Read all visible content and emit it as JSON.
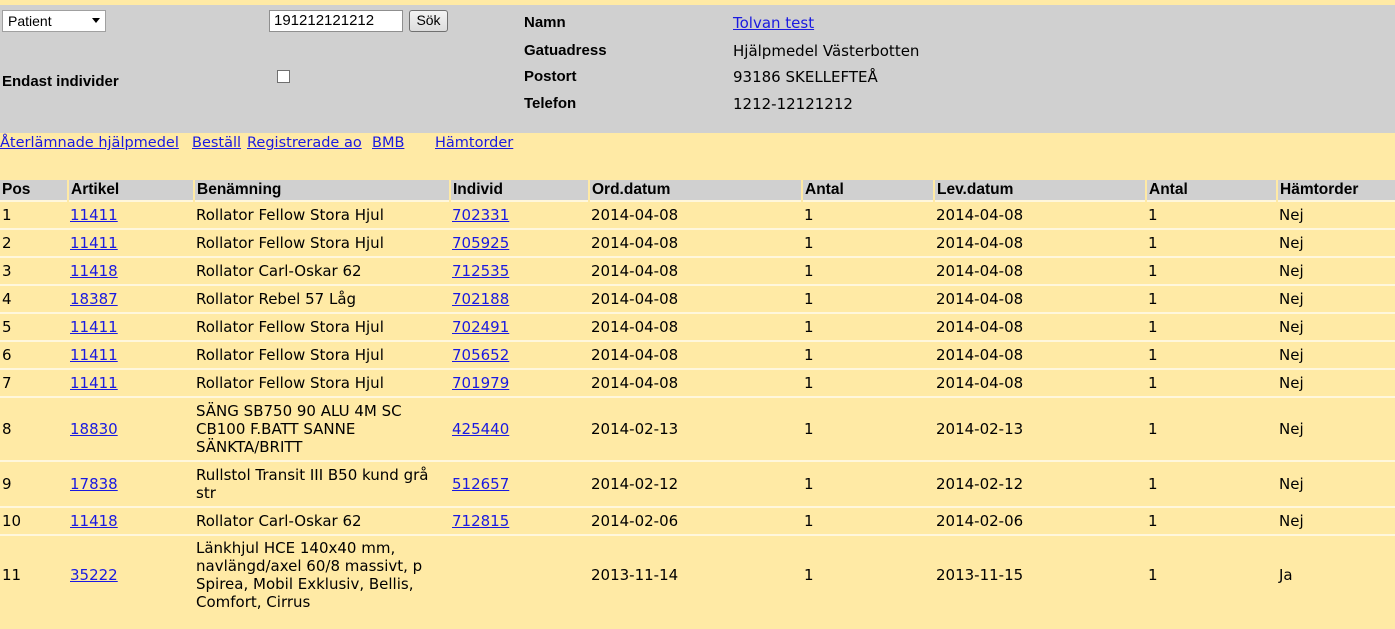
{
  "search": {
    "type_selected": "Patient",
    "query_value": "191212121212",
    "button_label": "Sök",
    "only_individuals_label": "Endast individer"
  },
  "patient": {
    "name_label": "Namn",
    "name_value": "Tolvan test",
    "address_label": "Gatuadress",
    "address_value": "Hjälpmedel Västerbotten",
    "city_label": "Postort",
    "city_value": "93186 SKELLEFTEÅ",
    "phone_label": "Telefon",
    "phone_value": "1212-12121212"
  },
  "links": [
    "Återlämnade hjälpmedel",
    "Beställ",
    "Registrerade ao",
    "BMB",
    "Hämtorder"
  ],
  "table": {
    "headers": [
      "Pos",
      "Artikel",
      "Benämning",
      "Individ",
      "Ord.datum",
      "Antal",
      "Lev.datum",
      "Antal",
      "Hämtorder"
    ],
    "rows": [
      {
        "pos": "1",
        "artikel": "11411",
        "benamning": "Rollator Fellow Stora Hjul",
        "individ": "702331",
        "ord": "2014-04-08",
        "antal": "1",
        "lev": "2014-04-08",
        "antal2": "1",
        "hamt": "Nej"
      },
      {
        "pos": "2",
        "artikel": "11411",
        "benamning": "Rollator Fellow Stora Hjul",
        "individ": "705925",
        "ord": "2014-04-08",
        "antal": "1",
        "lev": "2014-04-08",
        "antal2": "1",
        "hamt": "Nej"
      },
      {
        "pos": "3",
        "artikel": "11418",
        "benamning": "Rollator Carl-Oskar 62",
        "individ": "712535",
        "ord": "2014-04-08",
        "antal": "1",
        "lev": "2014-04-08",
        "antal2": "1",
        "hamt": "Nej"
      },
      {
        "pos": "4",
        "artikel": "18387",
        "benamning": "Rollator Rebel 57 Låg",
        "individ": "702188",
        "ord": "2014-04-08",
        "antal": "1",
        "lev": "2014-04-08",
        "antal2": "1",
        "hamt": "Nej"
      },
      {
        "pos": "5",
        "artikel": "11411",
        "benamning": "Rollator Fellow Stora Hjul",
        "individ": "702491",
        "ord": "2014-04-08",
        "antal": "1",
        "lev": "2014-04-08",
        "antal2": "1",
        "hamt": "Nej"
      },
      {
        "pos": "6",
        "artikel": "11411",
        "benamning": "Rollator Fellow Stora Hjul",
        "individ": "705652",
        "ord": "2014-04-08",
        "antal": "1",
        "lev": "2014-04-08",
        "antal2": "1",
        "hamt": "Nej"
      },
      {
        "pos": "7",
        "artikel": "11411",
        "benamning": "Rollator Fellow Stora Hjul",
        "individ": "701979",
        "ord": "2014-04-08",
        "antal": "1",
        "lev": "2014-04-08",
        "antal2": "1",
        "hamt": "Nej"
      },
      {
        "pos": "8",
        "artikel": "18830",
        "benamning": "SÄNG SB750 90 ALU 4M SC CB100 F.BATT SANNE SÄNKTA/BRITT",
        "individ": "425440",
        "ord": "2014-02-13",
        "antal": "1",
        "lev": "2014-02-13",
        "antal2": "1",
        "hamt": "Nej"
      },
      {
        "pos": "9",
        "artikel": "17838",
        "benamning": "Rullstol Transit III B50 kund grå str",
        "individ": "512657",
        "ord": "2014-02-12",
        "antal": "1",
        "lev": "2014-02-12",
        "antal2": "1",
        "hamt": "Nej"
      },
      {
        "pos": "10",
        "artikel": "11418",
        "benamning": "Rollator Carl-Oskar 62",
        "individ": "712815",
        "ord": "2014-02-06",
        "antal": "1",
        "lev": "2014-02-06",
        "antal2": "1",
        "hamt": "Nej"
      },
      {
        "pos": "11",
        "artikel": "35222",
        "benamning": "Länkhjul HCE 140x40 mm, navlängd/axel 60/8 massivt, p Spirea, Mobil Exklusiv, Bellis, Comfort, Cirrus",
        "individ": "",
        "ord": "2013-11-14",
        "antal": "1",
        "lev": "2013-11-15",
        "antal2": "1",
        "hamt": "Ja"
      }
    ]
  }
}
